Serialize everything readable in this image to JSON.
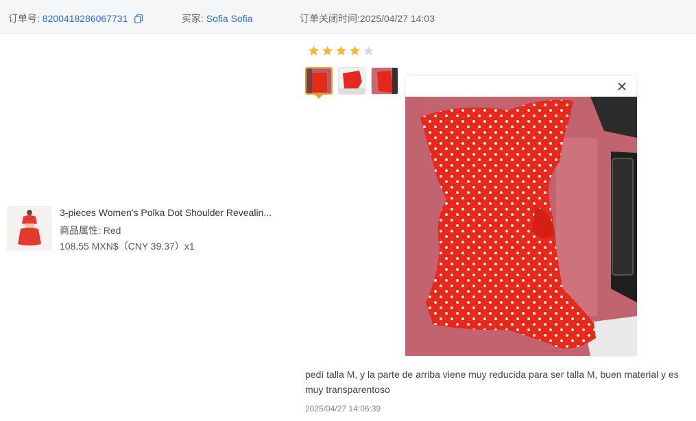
{
  "header": {
    "order_label": "订单号:",
    "order_number": "8200418286067731",
    "buyer_label": "买家:",
    "buyer_name": "Sofia Sofia",
    "closed_time_text": "订单关闭时间:2025/04/27 14:03"
  },
  "product": {
    "title": "3-pieces Women's Polka Dot Shoulder Revealin...",
    "attr_label": "商品属性:",
    "attr_value": "Red",
    "price": "108.55 MXN$（CNY  39.37）x1"
  },
  "review": {
    "rating": 4,
    "max_rating": 5,
    "photo_count": 3,
    "selected_photo": 1,
    "comment": "pedí talla M, y la parte de arriba viene muy reducida para ser talla M, buen material y es muy transparentoso",
    "timestamp": "2025/04/27 14:06:39"
  },
  "colors": {
    "link": "#2d6fcf",
    "star_active": "#f7b731",
    "star_inactive": "#d9d9d9",
    "selected_border": "#f0a020"
  },
  "icons": {
    "copy": "copy-icon",
    "close": "close-icon",
    "star": "star-icon"
  }
}
